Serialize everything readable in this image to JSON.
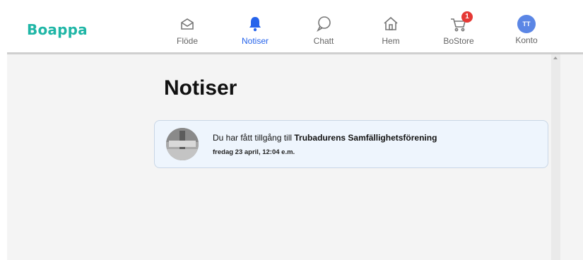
{
  "app": {
    "logo": "Boappa"
  },
  "nav": {
    "items": [
      {
        "label": "Flöde",
        "icon": "inbox-icon",
        "active": false
      },
      {
        "label": "Notiser",
        "icon": "bell-icon",
        "active": true
      },
      {
        "label": "Chatt",
        "icon": "chat-bubble-icon",
        "active": false
      },
      {
        "label": "Hem",
        "icon": "house-icon",
        "active": false
      },
      {
        "label": "BoStore",
        "icon": "cart-icon",
        "active": false,
        "badge": "1"
      },
      {
        "label": "Konto",
        "icon": "avatar",
        "active": false,
        "avatar_initials": "TT"
      }
    ]
  },
  "main": {
    "title": "Notiser",
    "notifications": [
      {
        "text_prefix": "Du har fått tillgång till ",
        "text_bold": "Trubadurens Samfällighetsförening",
        "time": "fredag 23 april, 12:04 e.m."
      }
    ]
  },
  "colors": {
    "brand": "#1fb6a6",
    "active_nav": "#2563eb",
    "badge": "#e53935",
    "avatar": "#5b86e5",
    "card_bg": "#eef5fd"
  }
}
